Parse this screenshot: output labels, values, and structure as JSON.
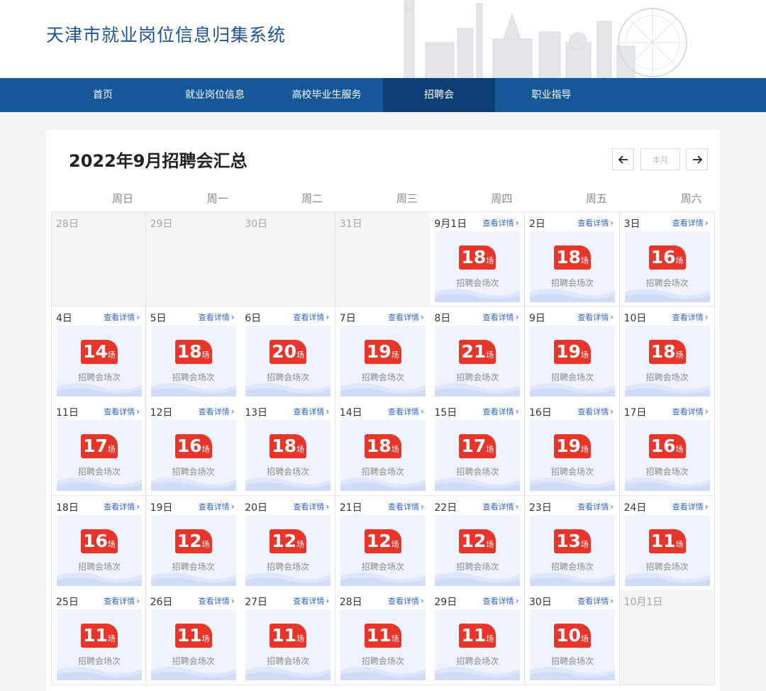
{
  "site_title": "天津市就业岗位信息归集系统",
  "nav": [
    "首页",
    "就业岗位信息",
    "高校毕业生服务",
    "招聘会",
    "职业指导"
  ],
  "nav_active_index": 3,
  "calendar": {
    "title": "2022年9月招聘会汇总",
    "this_month_label": "本月",
    "weekdays": [
      "周日",
      "周一",
      "周二",
      "周三",
      "周四",
      "周五",
      "周六"
    ],
    "detail_label": "查看详情",
    "unit_label": "场",
    "caption": "招聘会场次",
    "days": [
      {
        "label": "28日",
        "in_month": false
      },
      {
        "label": "29日",
        "in_month": false
      },
      {
        "label": "30日",
        "in_month": false
      },
      {
        "label": "31日",
        "in_month": false
      },
      {
        "label": "9月1日",
        "in_month": true,
        "count": 18
      },
      {
        "label": "2日",
        "in_month": true,
        "count": 18
      },
      {
        "label": "3日",
        "in_month": true,
        "count": 16
      },
      {
        "label": "4日",
        "in_month": true,
        "count": 14
      },
      {
        "label": "5日",
        "in_month": true,
        "count": 18
      },
      {
        "label": "6日",
        "in_month": true,
        "count": 20
      },
      {
        "label": "7日",
        "in_month": true,
        "count": 19
      },
      {
        "label": "8日",
        "in_month": true,
        "count": 21
      },
      {
        "label": "9日",
        "in_month": true,
        "count": 19
      },
      {
        "label": "10日",
        "in_month": true,
        "count": 18
      },
      {
        "label": "11日",
        "in_month": true,
        "count": 17
      },
      {
        "label": "12日",
        "in_month": true,
        "count": 16
      },
      {
        "label": "13日",
        "in_month": true,
        "count": 18
      },
      {
        "label": "14日",
        "in_month": true,
        "count": 18
      },
      {
        "label": "15日",
        "in_month": true,
        "count": 17
      },
      {
        "label": "16日",
        "in_month": true,
        "count": 19
      },
      {
        "label": "17日",
        "in_month": true,
        "count": 16
      },
      {
        "label": "18日",
        "in_month": true,
        "count": 16
      },
      {
        "label": "19日",
        "in_month": true,
        "count": 12
      },
      {
        "label": "20日",
        "in_month": true,
        "count": 12
      },
      {
        "label": "21日",
        "in_month": true,
        "count": 12
      },
      {
        "label": "22日",
        "in_month": true,
        "count": 12
      },
      {
        "label": "23日",
        "in_month": true,
        "count": 13
      },
      {
        "label": "24日",
        "in_month": true,
        "count": 11
      },
      {
        "label": "25日",
        "in_month": true,
        "count": 11
      },
      {
        "label": "26日",
        "in_month": true,
        "count": 11
      },
      {
        "label": "27日",
        "in_month": true,
        "count": 11
      },
      {
        "label": "28日",
        "in_month": true,
        "count": 11
      },
      {
        "label": "29日",
        "in_month": true,
        "count": 11
      },
      {
        "label": "30日",
        "in_month": true,
        "count": 10
      },
      {
        "label": "10月1日",
        "in_month": false
      }
    ]
  },
  "colors": {
    "brand_blue": "#15589a",
    "nav_active": "#0d3f76",
    "badge_red": "#e8352a",
    "link_blue": "#2f66c9",
    "card_bg": "#eef3fd"
  },
  "icons": {
    "prev": "arrow-left-icon",
    "next": "arrow-right-icon",
    "detail": "chevron-right-icon"
  }
}
